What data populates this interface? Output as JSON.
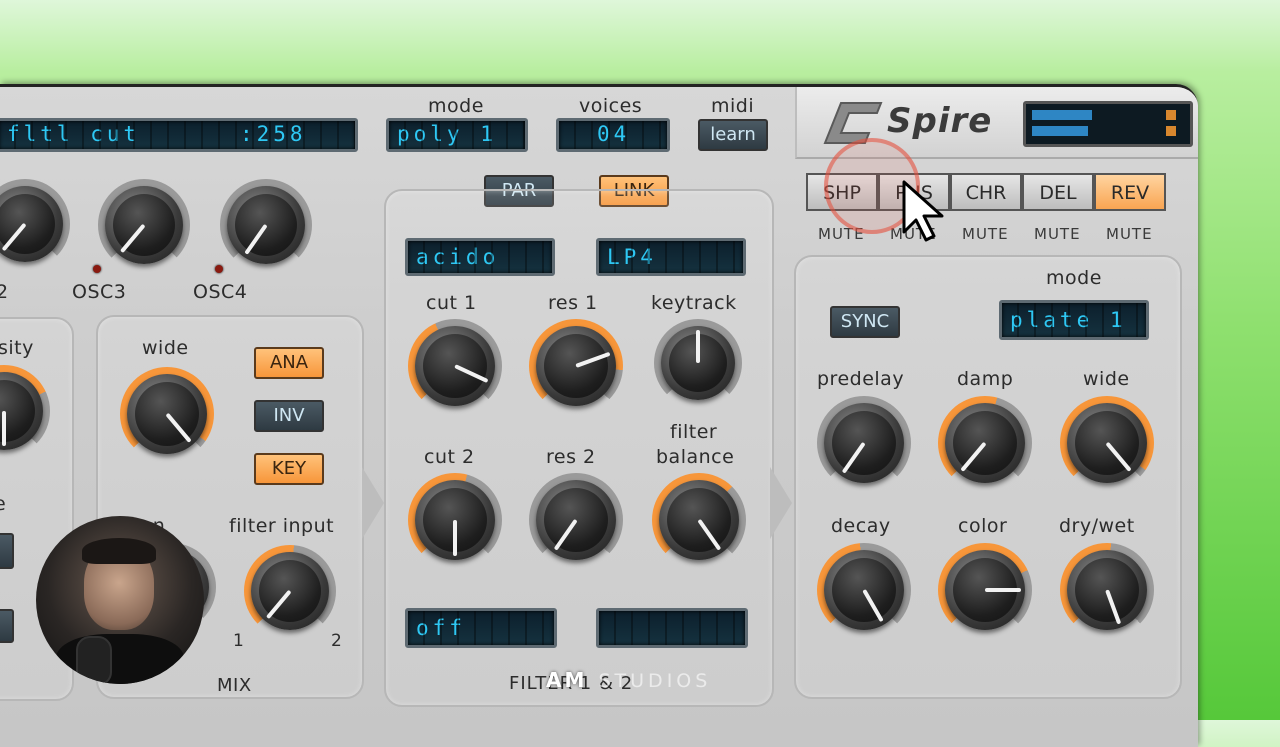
{
  "header": {
    "param_display": "fltl cut      :258",
    "mode_label": "mode",
    "mode_value": "poly 1",
    "voices_label": "voices",
    "voices_value": "04",
    "midi_label": "midi",
    "learn_label": "learn",
    "logo_text": "Spire"
  },
  "osc": {
    "osc3": "OSC3",
    "osc4": "OSC4",
    "osc2_partial": "2"
  },
  "mixer": {
    "density_partial": "sity",
    "wide": "wide",
    "ana": "ANA",
    "inv": "INV",
    "key": "KEY",
    "pan_partial": "pan",
    "filter_input": "filter input",
    "input_1": "1",
    "input_2": "2",
    "mix": "MIX",
    "e_partial": "e"
  },
  "filter": {
    "par": "PAR",
    "link": "LINK",
    "type1": "acido",
    "type2": "LP4",
    "cut1": "cut 1",
    "res1": "res 1",
    "keytrack": "keytrack",
    "cut2": "cut 2",
    "res2": "res 2",
    "filter_balance_1": "filter",
    "filter_balance_2": "balance",
    "bottom1": "off",
    "bottom2": "",
    "title": "FILTER 1 & 2"
  },
  "fx": {
    "tabs": [
      "SHP",
      "PHS",
      "CHR",
      "DEL",
      "REV"
    ],
    "active_tab": "REV",
    "mute": "MUTE",
    "sync": "SYNC",
    "mode_label": "mode",
    "mode_value": "plate 1",
    "predelay": "predelay",
    "damp": "damp",
    "wide": "wide",
    "decay": "decay",
    "color": "color",
    "dry_wet": "dry/wet"
  },
  "watermark": {
    "am": "AM",
    "studios": "STUDIOS"
  },
  "colors": {
    "accent_orange": "#f7963a",
    "lcd_text": "#2ec8f4",
    "background_green": "#56c83a"
  }
}
